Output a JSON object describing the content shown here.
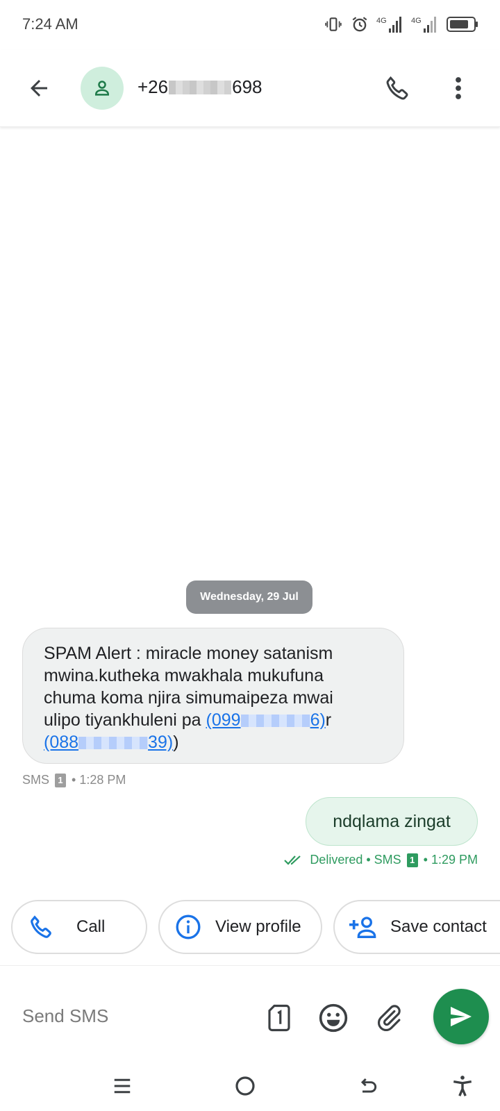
{
  "status_bar": {
    "time": "7:24 AM",
    "network_1": "4G",
    "network_2": "4G",
    "icons": [
      "vibrate-icon",
      "alarm-icon",
      "signal-icon",
      "signal-icon",
      "battery-icon"
    ]
  },
  "header": {
    "contact_name_start": "+26",
    "contact_name_end": "698",
    "icons": [
      "back-arrow-icon",
      "person-icon",
      "phone-icon",
      "more-vert-icon"
    ]
  },
  "conversation": {
    "date_chip": "Wednesday, 29 Jul",
    "incoming": {
      "line1": "SPAM Alert : miracle money satanism",
      "line2": "mwina.kutheka mwakhala mukufuna",
      "line3": "chuma koma njira simumaipeza mwai",
      "line4_text": "ulipo tiyankhuleni pa",
      "link1_start": "(099",
      "link1_end": "6)",
      "link1_suffix": "r",
      "link2_start": "(088",
      "link2_end": "39)",
      "line5_suffix": ")",
      "meta_type": "SMS",
      "meta_sim": "1",
      "meta_time": "• 1:28 PM"
    },
    "outgoing": {
      "text": "ndqlama zingat",
      "status": "Delivered • SMS",
      "sim": "1",
      "time": "• 1:29 PM"
    }
  },
  "suggestions": [
    {
      "label": "Call",
      "icon": "phone-icon"
    },
    {
      "label": "View profile",
      "icon": "info-icon"
    },
    {
      "label": "Save contact",
      "icon": "add-person-icon"
    }
  ],
  "compose": {
    "placeholder": "Send SMS",
    "icons": [
      "sim-icon",
      "emoji-icon",
      "attach-icon",
      "send-icon"
    ]
  },
  "colors": {
    "accent_green": "#1e8e4f",
    "link_blue": "#1a73e8",
    "avatar_bg": "#cfeedd"
  },
  "nav_bar": {
    "icons": [
      "menu-icon",
      "home-icon",
      "back-icon",
      "accessibility-icon"
    ]
  }
}
